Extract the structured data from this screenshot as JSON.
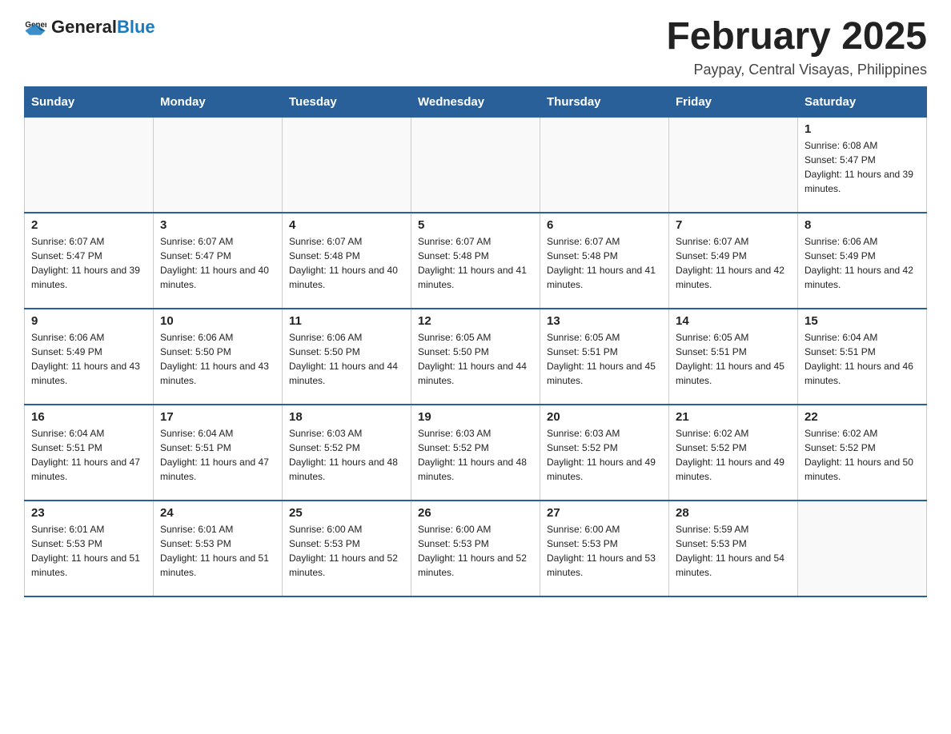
{
  "header": {
    "logo_general": "General",
    "logo_blue": "Blue",
    "month_title": "February 2025",
    "subtitle": "Paypay, Central Visayas, Philippines"
  },
  "weekdays": [
    "Sunday",
    "Monday",
    "Tuesday",
    "Wednesday",
    "Thursday",
    "Friday",
    "Saturday"
  ],
  "weeks": [
    [
      {
        "day": "",
        "info": ""
      },
      {
        "day": "",
        "info": ""
      },
      {
        "day": "",
        "info": ""
      },
      {
        "day": "",
        "info": ""
      },
      {
        "day": "",
        "info": ""
      },
      {
        "day": "",
        "info": ""
      },
      {
        "day": "1",
        "info": "Sunrise: 6:08 AM\nSunset: 5:47 PM\nDaylight: 11 hours and 39 minutes."
      }
    ],
    [
      {
        "day": "2",
        "info": "Sunrise: 6:07 AM\nSunset: 5:47 PM\nDaylight: 11 hours and 39 minutes."
      },
      {
        "day": "3",
        "info": "Sunrise: 6:07 AM\nSunset: 5:47 PM\nDaylight: 11 hours and 40 minutes."
      },
      {
        "day": "4",
        "info": "Sunrise: 6:07 AM\nSunset: 5:48 PM\nDaylight: 11 hours and 40 minutes."
      },
      {
        "day": "5",
        "info": "Sunrise: 6:07 AM\nSunset: 5:48 PM\nDaylight: 11 hours and 41 minutes."
      },
      {
        "day": "6",
        "info": "Sunrise: 6:07 AM\nSunset: 5:48 PM\nDaylight: 11 hours and 41 minutes."
      },
      {
        "day": "7",
        "info": "Sunrise: 6:07 AM\nSunset: 5:49 PM\nDaylight: 11 hours and 42 minutes."
      },
      {
        "day": "8",
        "info": "Sunrise: 6:06 AM\nSunset: 5:49 PM\nDaylight: 11 hours and 42 minutes."
      }
    ],
    [
      {
        "day": "9",
        "info": "Sunrise: 6:06 AM\nSunset: 5:49 PM\nDaylight: 11 hours and 43 minutes."
      },
      {
        "day": "10",
        "info": "Sunrise: 6:06 AM\nSunset: 5:50 PM\nDaylight: 11 hours and 43 minutes."
      },
      {
        "day": "11",
        "info": "Sunrise: 6:06 AM\nSunset: 5:50 PM\nDaylight: 11 hours and 44 minutes."
      },
      {
        "day": "12",
        "info": "Sunrise: 6:05 AM\nSunset: 5:50 PM\nDaylight: 11 hours and 44 minutes."
      },
      {
        "day": "13",
        "info": "Sunrise: 6:05 AM\nSunset: 5:51 PM\nDaylight: 11 hours and 45 minutes."
      },
      {
        "day": "14",
        "info": "Sunrise: 6:05 AM\nSunset: 5:51 PM\nDaylight: 11 hours and 45 minutes."
      },
      {
        "day": "15",
        "info": "Sunrise: 6:04 AM\nSunset: 5:51 PM\nDaylight: 11 hours and 46 minutes."
      }
    ],
    [
      {
        "day": "16",
        "info": "Sunrise: 6:04 AM\nSunset: 5:51 PM\nDaylight: 11 hours and 47 minutes."
      },
      {
        "day": "17",
        "info": "Sunrise: 6:04 AM\nSunset: 5:51 PM\nDaylight: 11 hours and 47 minutes."
      },
      {
        "day": "18",
        "info": "Sunrise: 6:03 AM\nSunset: 5:52 PM\nDaylight: 11 hours and 48 minutes."
      },
      {
        "day": "19",
        "info": "Sunrise: 6:03 AM\nSunset: 5:52 PM\nDaylight: 11 hours and 48 minutes."
      },
      {
        "day": "20",
        "info": "Sunrise: 6:03 AM\nSunset: 5:52 PM\nDaylight: 11 hours and 49 minutes."
      },
      {
        "day": "21",
        "info": "Sunrise: 6:02 AM\nSunset: 5:52 PM\nDaylight: 11 hours and 49 minutes."
      },
      {
        "day": "22",
        "info": "Sunrise: 6:02 AM\nSunset: 5:52 PM\nDaylight: 11 hours and 50 minutes."
      }
    ],
    [
      {
        "day": "23",
        "info": "Sunrise: 6:01 AM\nSunset: 5:53 PM\nDaylight: 11 hours and 51 minutes."
      },
      {
        "day": "24",
        "info": "Sunrise: 6:01 AM\nSunset: 5:53 PM\nDaylight: 11 hours and 51 minutes."
      },
      {
        "day": "25",
        "info": "Sunrise: 6:00 AM\nSunset: 5:53 PM\nDaylight: 11 hours and 52 minutes."
      },
      {
        "day": "26",
        "info": "Sunrise: 6:00 AM\nSunset: 5:53 PM\nDaylight: 11 hours and 52 minutes."
      },
      {
        "day": "27",
        "info": "Sunrise: 6:00 AM\nSunset: 5:53 PM\nDaylight: 11 hours and 53 minutes."
      },
      {
        "day": "28",
        "info": "Sunrise: 5:59 AM\nSunset: 5:53 PM\nDaylight: 11 hours and 54 minutes."
      },
      {
        "day": "",
        "info": ""
      }
    ]
  ]
}
